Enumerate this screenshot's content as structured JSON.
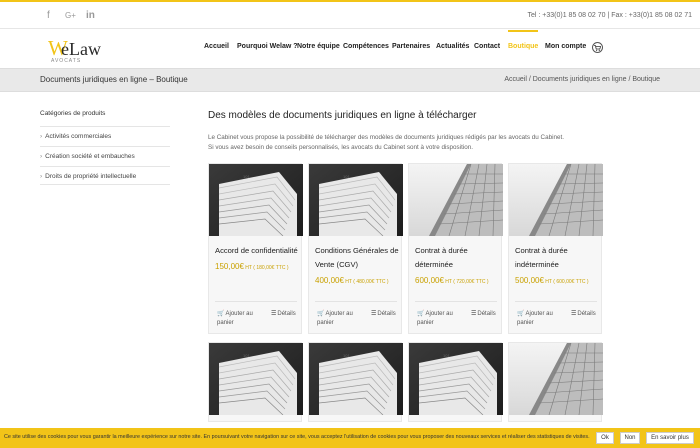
{
  "top_bar": {
    "social": [
      "f",
      "G+",
      "in"
    ],
    "contact": "Tel : +33(0)1 85 08 02 70 | Fax : +33(0)1 85 08 02 71"
  },
  "logo": {
    "initial": "W",
    "rest": "eLaw",
    "sub": "AVOCATS"
  },
  "nav": [
    "Accueil",
    "Pourquoi Welaw ?",
    "Notre équipe",
    "Compétences",
    "Partenaires",
    "Actualités",
    "Contact",
    "Boutique",
    "Mon compte"
  ],
  "nav_active": "Boutique",
  "colors": {
    "accent": "#f2c418",
    "price": "#c9a100"
  },
  "title_bar": {
    "title": "Documents juridiques en ligne – Boutique",
    "breadcrumb": "Accueil / Documents juridiques en ligne / Boutique"
  },
  "sidebar": {
    "title": "Catégories de produits",
    "items": [
      "Activités commerciales",
      "Création société et embauches",
      "Droits de propriété intellectuelle"
    ]
  },
  "main": {
    "heading": "Des modèles de documents juridiques en ligne à télécharger",
    "intro_line1": "Le Cabinet vous propose la possibilité de télécharger des modèles de documents juridiques rédigés par les avocats du Cabinet.",
    "intro_line2": "Si vous avez besoin de conseils personnalisés, les avocats du Cabinet sont à votre disposition."
  },
  "products": [
    {
      "title_l1": "Accord de confidentialité",
      "title_l2": "",
      "price": "150,00€",
      "ht": " HT",
      "ttc": " ( 180,00€ TTC )",
      "image": "documents"
    },
    {
      "title_l1": "Conditions Générales de",
      "title_l2": "Vente (CGV)",
      "price": "400,00€",
      "ht": " HT",
      "ttc": " ( 480,00€ TTC )",
      "image": "documents"
    },
    {
      "title_l1": "Contrat à durée",
      "title_l2": "déterminée",
      "price": "600,00€",
      "ht": " HT",
      "ttc": " ( 720,00€ TTC )",
      "image": "building"
    },
    {
      "title_l1": "Contrat à durée",
      "title_l2": "indéterminée",
      "price": "500,00€",
      "ht": " HT",
      "ttc": " ( 600,00€ TTC )",
      "image": "building"
    }
  ],
  "card_actions": {
    "add_l1": "Ajouter au",
    "add_l2": "panier",
    "details": "Détails"
  },
  "cookie": {
    "text": "Ce site utilise des cookies pour vous garantir la meilleure expérience sur notre site. En poursuivant votre navigation sur ce site, vous acceptez l'utilisation de cookies pour vous proposer des nouveaux services et réaliser des statistiques de visites.",
    "ok": "Ok",
    "no": "Non",
    "more": "En savoir plus"
  }
}
